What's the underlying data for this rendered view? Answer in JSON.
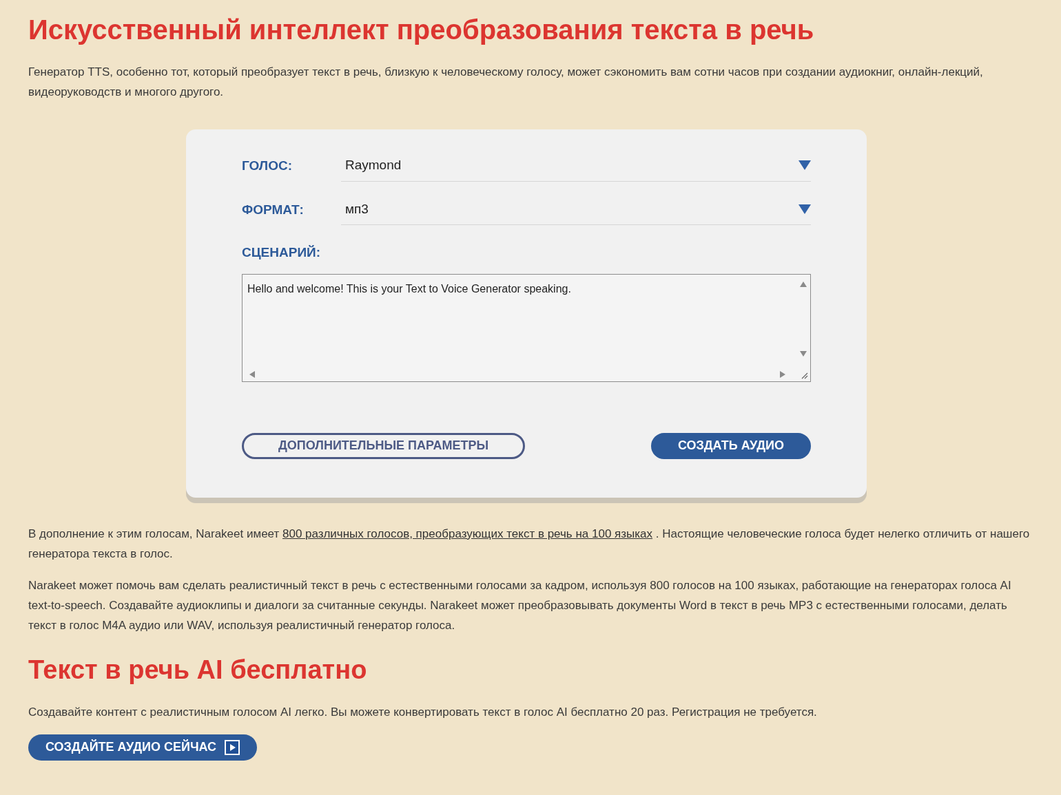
{
  "title": "Искусственный интеллект преобразования текста в речь",
  "intro": "Генератор TTS, особенно тот, который преобразует текст в речь, близкую к человеческому голосу, может сэкономить вам сотни часов при создании аудиокниг, онлайн-лекций, видеоруководств и многого другого.",
  "form": {
    "fields": [
      {
        "label": "ГОЛОС:",
        "value": "Raymond",
        "kind": "select"
      },
      {
        "label": "ФОРМАТ:",
        "value": "мп3",
        "kind": "select"
      },
      {
        "label": "СЦЕНАРИЙ:",
        "value": "Hello and welcome! This is your Text to Voice Generator speaking.",
        "kind": "textarea"
      }
    ],
    "buttons": [
      {
        "label": "ДОПОЛНИТЕЛЬНЫЕ ПАРАМЕТРЫ",
        "kind": "outline"
      },
      {
        "label": "СОЗДАТЬ АУДИО",
        "kind": "filled"
      }
    ]
  },
  "paragraph_with_link": {
    "before": "В дополнение к этим голосам, Narakeet имеет ",
    "link": "800 различных голосов, преобразующих текст в речь на 100 языках",
    "after": " . Настоящие человеческие голоса будет нелегко отличить от нашего генератора текста в голос."
  },
  "paragraph": "Narakeet может помочь вам сделать реалистичный текст в речь с естественными голосами за кадром, используя 800 голосов на 100 языках, работающие на генераторах голоса AI text-to-speech. Создавайте аудиоклипы и диалоги за считанные секунды. Narakeet может преобразовывать документы Word в текст в речь MP3 с естественными голосами, делать текст в голос M4A аудио или WAV, используя реалистичный генератор голоса.",
  "subtitle": "Текст в речь AI бесплатно",
  "free_text": "Создавайте контент с реалистичным голосом AI легко. Вы можете конвертировать текст в голос AI бесплатно 20 раз. Регистрация не требуется.",
  "cta": {
    "label": "СОЗДАЙТЕ АУДИО СЕЙЧАС"
  }
}
